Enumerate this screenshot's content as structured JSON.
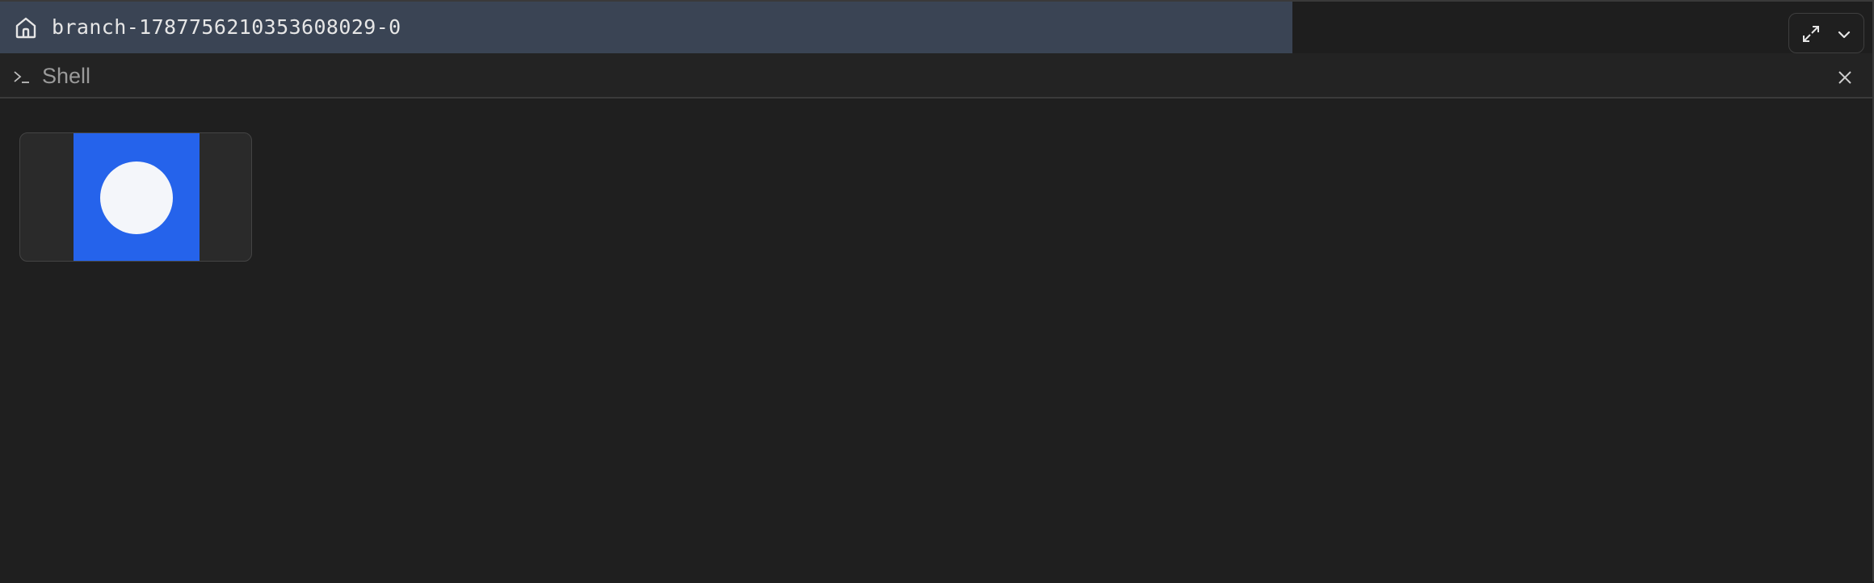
{
  "topbar": {
    "branch_name": "branch-1787756210353608029-0",
    "icons": {
      "home": "home-icon",
      "expand": "expand-icon",
      "dropdown": "chevron-down-icon"
    }
  },
  "shell": {
    "title": "Shell",
    "icons": {
      "prompt": "terminal-prompt-icon",
      "close": "close-icon"
    }
  },
  "content": {
    "thumbnail": {
      "icon": "record-circle-icon"
    }
  },
  "colors": {
    "tab_background": "#3a4454",
    "background": "#1f1f1f",
    "accent_blue": "#2563eb",
    "dot": "#f4f6fa"
  }
}
